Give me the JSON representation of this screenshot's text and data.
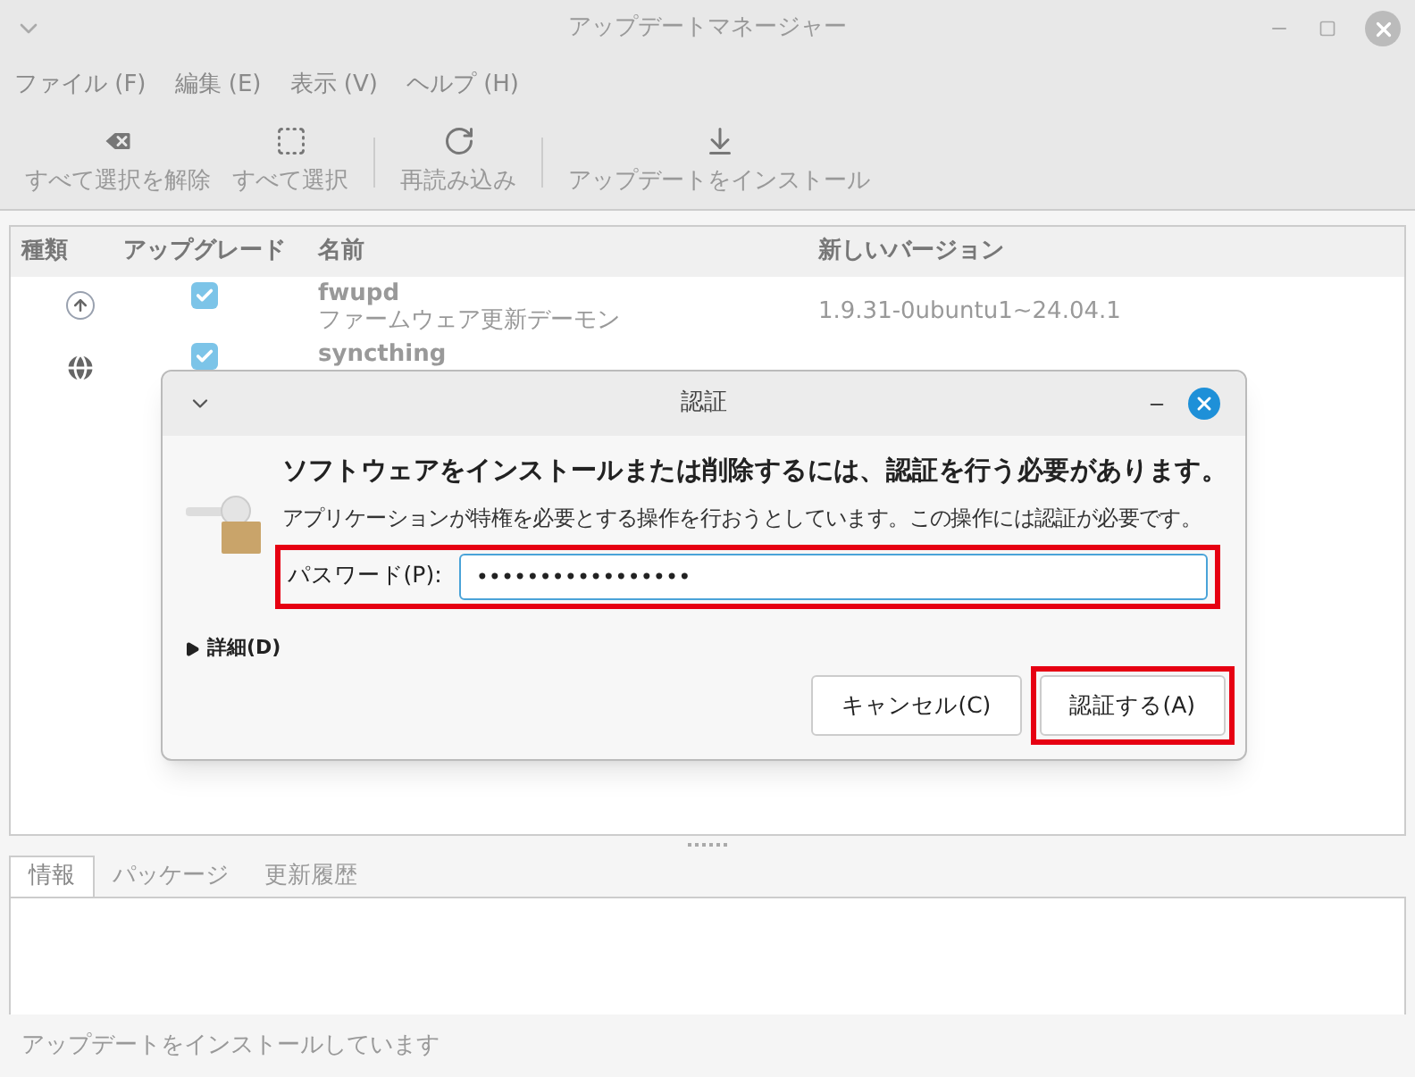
{
  "window": {
    "title": "アップデートマネージャー"
  },
  "menu": [
    "ファイル (F)",
    "編集 (E)",
    "表示 (V)",
    "ヘルプ (H)"
  ],
  "toolbar": [
    [
      {
        "label": "すべて選択を解除",
        "kind": "clear"
      },
      {
        "label": "すべて選択",
        "kind": "select"
      }
    ],
    [
      {
        "label": "再読み込み",
        "kind": "reload"
      }
    ],
    [
      {
        "label": "アップデートをインストール",
        "kind": "install"
      }
    ]
  ],
  "table": {
    "columns": [
      "種類",
      "アップグレード",
      "名前",
      "新しいバージョン"
    ],
    "rows": [
      {
        "kind": "system",
        "checked": true,
        "name": "fwupd",
        "description": "ファームウェア更新デーモン",
        "version": "1.9.31-0ubuntu1~24.04.1"
      },
      {
        "kind": "web",
        "checked": true,
        "name": "syncthing"
      }
    ]
  },
  "tabs": [
    {
      "label": "情報",
      "selected": true
    },
    {
      "label": "パッケージ",
      "selected": false
    },
    {
      "label": "更新履歴",
      "selected": false
    }
  ],
  "status_bar": "アップデートをインストールしています",
  "dialog": {
    "title": "認証",
    "heading": "ソフトウェアをインストールまたは削除するには、認証を行う必要があります。",
    "message": "アプリケーションが特権を必要とする操作を行おうとしています。この操作には認証が必要です。",
    "password": {
      "label": "パスワード(P):",
      "value": "•••••••••••••••••",
      "highlighted": true
    },
    "details": {
      "label": "詳細(D)",
      "expanded": false
    },
    "buttons": [
      {
        "label": "キャンセル(C)",
        "highlighted": false
      },
      {
        "label": "認証する(A)",
        "highlighted": true
      }
    ]
  }
}
